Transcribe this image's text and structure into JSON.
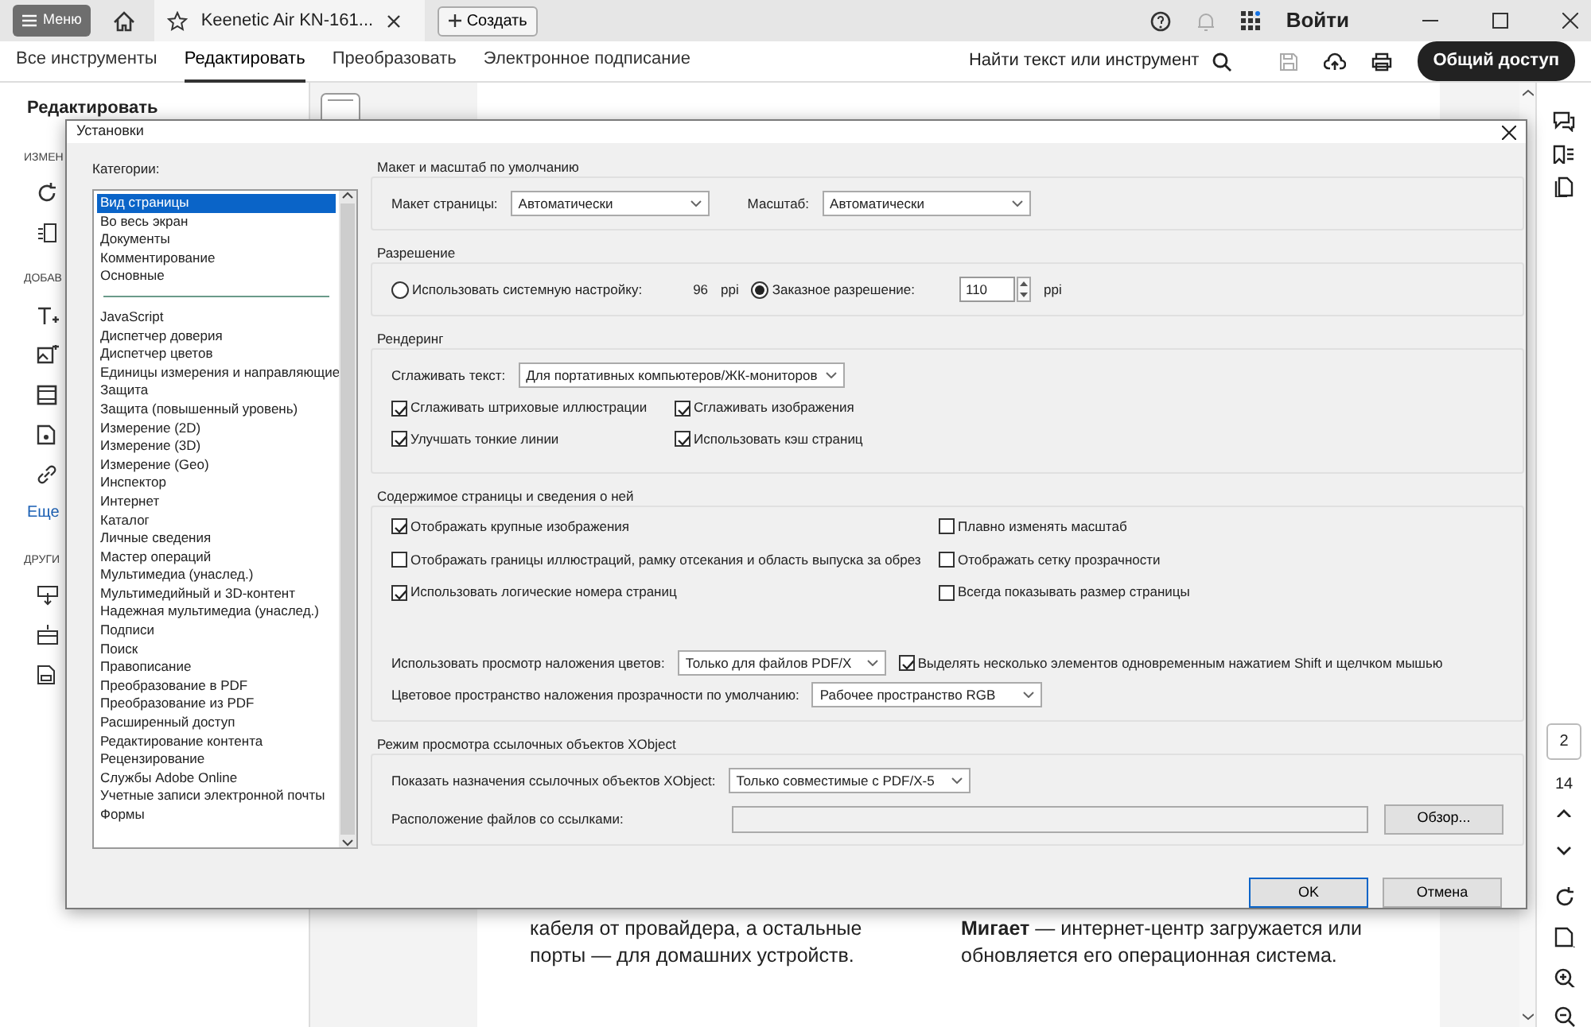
{
  "titlebar": {
    "menu_button": "Меню",
    "tab_title": "Keenetic Air KN-161...",
    "create_button": "Создать",
    "login": "Войти"
  },
  "toolbar": {
    "tabs": [
      {
        "label": "Все инструменты",
        "selected": false
      },
      {
        "label": "Редактировать",
        "selected": true
      },
      {
        "label": "Преобразовать",
        "selected": false
      },
      {
        "label": "Электронное подписание",
        "selected": false
      }
    ],
    "search": "Найти текст или инструмент",
    "share_button": "Общий доступ"
  },
  "left_panel": {
    "title": "Редактировать",
    "headings": [
      "ИЗМЕН",
      "ДОБАВ",
      "ДРУГИ"
    ],
    "more_link": "Еще"
  },
  "document": {
    "columns": [
      [
        "кабеля от провайдера, а остальные",
        "порты — для домашних устройств."
      ],
      [
        "**Мигает** — интернет-центр загружается или",
        "обновляется его операционная система."
      ]
    ]
  },
  "right_rail": {
    "page_current": "2",
    "page_total": "14"
  },
  "dialog": {
    "title": "Установки",
    "categories_label": "Категории:",
    "category_groups": [
      [
        {
          "label": "Вид страницы",
          "selected": true
        },
        {
          "label": "Во весь экран",
          "selected": false
        },
        {
          "label": "Документы",
          "selected": false
        },
        {
          "label": "Комментирование",
          "selected": false
        },
        {
          "label": "Основные",
          "selected": false
        }
      ],
      [
        {
          "label": "JavaScript",
          "selected": false
        },
        {
          "label": "Диспетчер доверия",
          "selected": false
        },
        {
          "label": "Диспетчер цветов",
          "selected": false
        },
        {
          "label": "Единицы измерения и направляющие",
          "selected": false
        },
        {
          "label": "Защита",
          "selected": false
        },
        {
          "label": "Защита (повышенный уровень)",
          "selected": false
        },
        {
          "label": "Измерение (2D)",
          "selected": false
        },
        {
          "label": "Измерение (3D)",
          "selected": false
        },
        {
          "label": "Измерение (Geo)",
          "selected": false
        },
        {
          "label": "Инспектор",
          "selected": false
        },
        {
          "label": "Интернет",
          "selected": false
        },
        {
          "label": "Каталог",
          "selected": false
        },
        {
          "label": "Личные сведения",
          "selected": false
        },
        {
          "label": "Мастер операций",
          "selected": false
        },
        {
          "label": "Мультимедиа (унаслед.)",
          "selected": false
        },
        {
          "label": "Мультимедийный и 3D-контент",
          "selected": false
        },
        {
          "label": "Надежная мультимедиа (унаслед.)",
          "selected": false
        },
        {
          "label": "Подписи",
          "selected": false
        },
        {
          "label": "Поиск",
          "selected": false
        },
        {
          "label": "Правописание",
          "selected": false
        },
        {
          "label": "Преобразование в PDF",
          "selected": false
        },
        {
          "label": "Преобразование из PDF",
          "selected": false
        },
        {
          "label": "Расширенный доступ",
          "selected": false
        },
        {
          "label": "Редактирование контента",
          "selected": false
        },
        {
          "label": "Рецензирование",
          "selected": false
        },
        {
          "label": "Службы Adobe Online",
          "selected": false
        },
        {
          "label": "Учетные записи электронной почты",
          "selected": false
        },
        {
          "label": "Формы",
          "selected": false
        }
      ]
    ],
    "layout": {
      "heading": "Макет и масштаб по умолчанию",
      "page_layout_label": "Макет страницы:",
      "page_layout_value": "Автоматически",
      "zoom_label": "Масштаб:",
      "zoom_value": "Автоматически"
    },
    "resolution": {
      "heading": "Разрешение",
      "system": {
        "label": "Использовать системную настройку:",
        "value": "96",
        "unit": "ppi",
        "selected": false
      },
      "custom": {
        "label": "Заказное разрешение:",
        "value": "110",
        "unit": "ppi",
        "selected": true
      }
    },
    "rendering": {
      "heading": "Рендеринг",
      "smooth_text_label": "Сглаживать текст:",
      "smooth_text_value": "Для портативных компьютеров/ЖК-мониторов",
      "options": [
        {
          "label": "Сглаживать штриховые иллюстрации",
          "checked": true
        },
        {
          "label": "Сглаживать изображения",
          "checked": true
        },
        {
          "label": "Улучшать тонкие линии",
          "checked": true
        },
        {
          "label": "Использовать кэш страниц",
          "checked": true
        }
      ]
    },
    "content": {
      "heading": "Содержимое страницы и сведения о ней",
      "options": [
        {
          "label": "Отображать крупные изображения",
          "checked": true
        },
        {
          "label": "Плавно изменять масштаб",
          "checked": false
        },
        {
          "label": "Отображать границы иллюстраций, рамку отсекания и область выпуска за обрез",
          "checked": false
        },
        {
          "label": "Отображать сетку прозрачности",
          "checked": false
        },
        {
          "label": "Использовать логические номера страниц",
          "checked": true
        },
        {
          "label": "Всегда показывать размер страницы",
          "checked": false
        }
      ],
      "overprint_label": "Использовать просмотр наложения цветов:",
      "overprint_value": "Только для файлов PDF/X",
      "shift_select": {
        "label": "Выделять несколько элементов одновременным нажатием Shift и щелчком мышью",
        "checked": true
      },
      "blend_label": "Цветовое пространство наложения прозрачности по умолчанию:",
      "blend_value": "Рабочее пространство RGB"
    },
    "xobject": {
      "heading": "Режим просмотра ссылочных объектов XObject",
      "show_label": "Показать назначения ссылочных объектов XObject:",
      "show_value": "Только совместимые с PDF/X-5",
      "location_label": "Расположение файлов со ссылками:",
      "browse_button": "Обзор..."
    },
    "buttons": [
      {
        "label": "OK",
        "kind": "default"
      },
      {
        "label": "Отмена",
        "kind": "normal"
      }
    ]
  }
}
